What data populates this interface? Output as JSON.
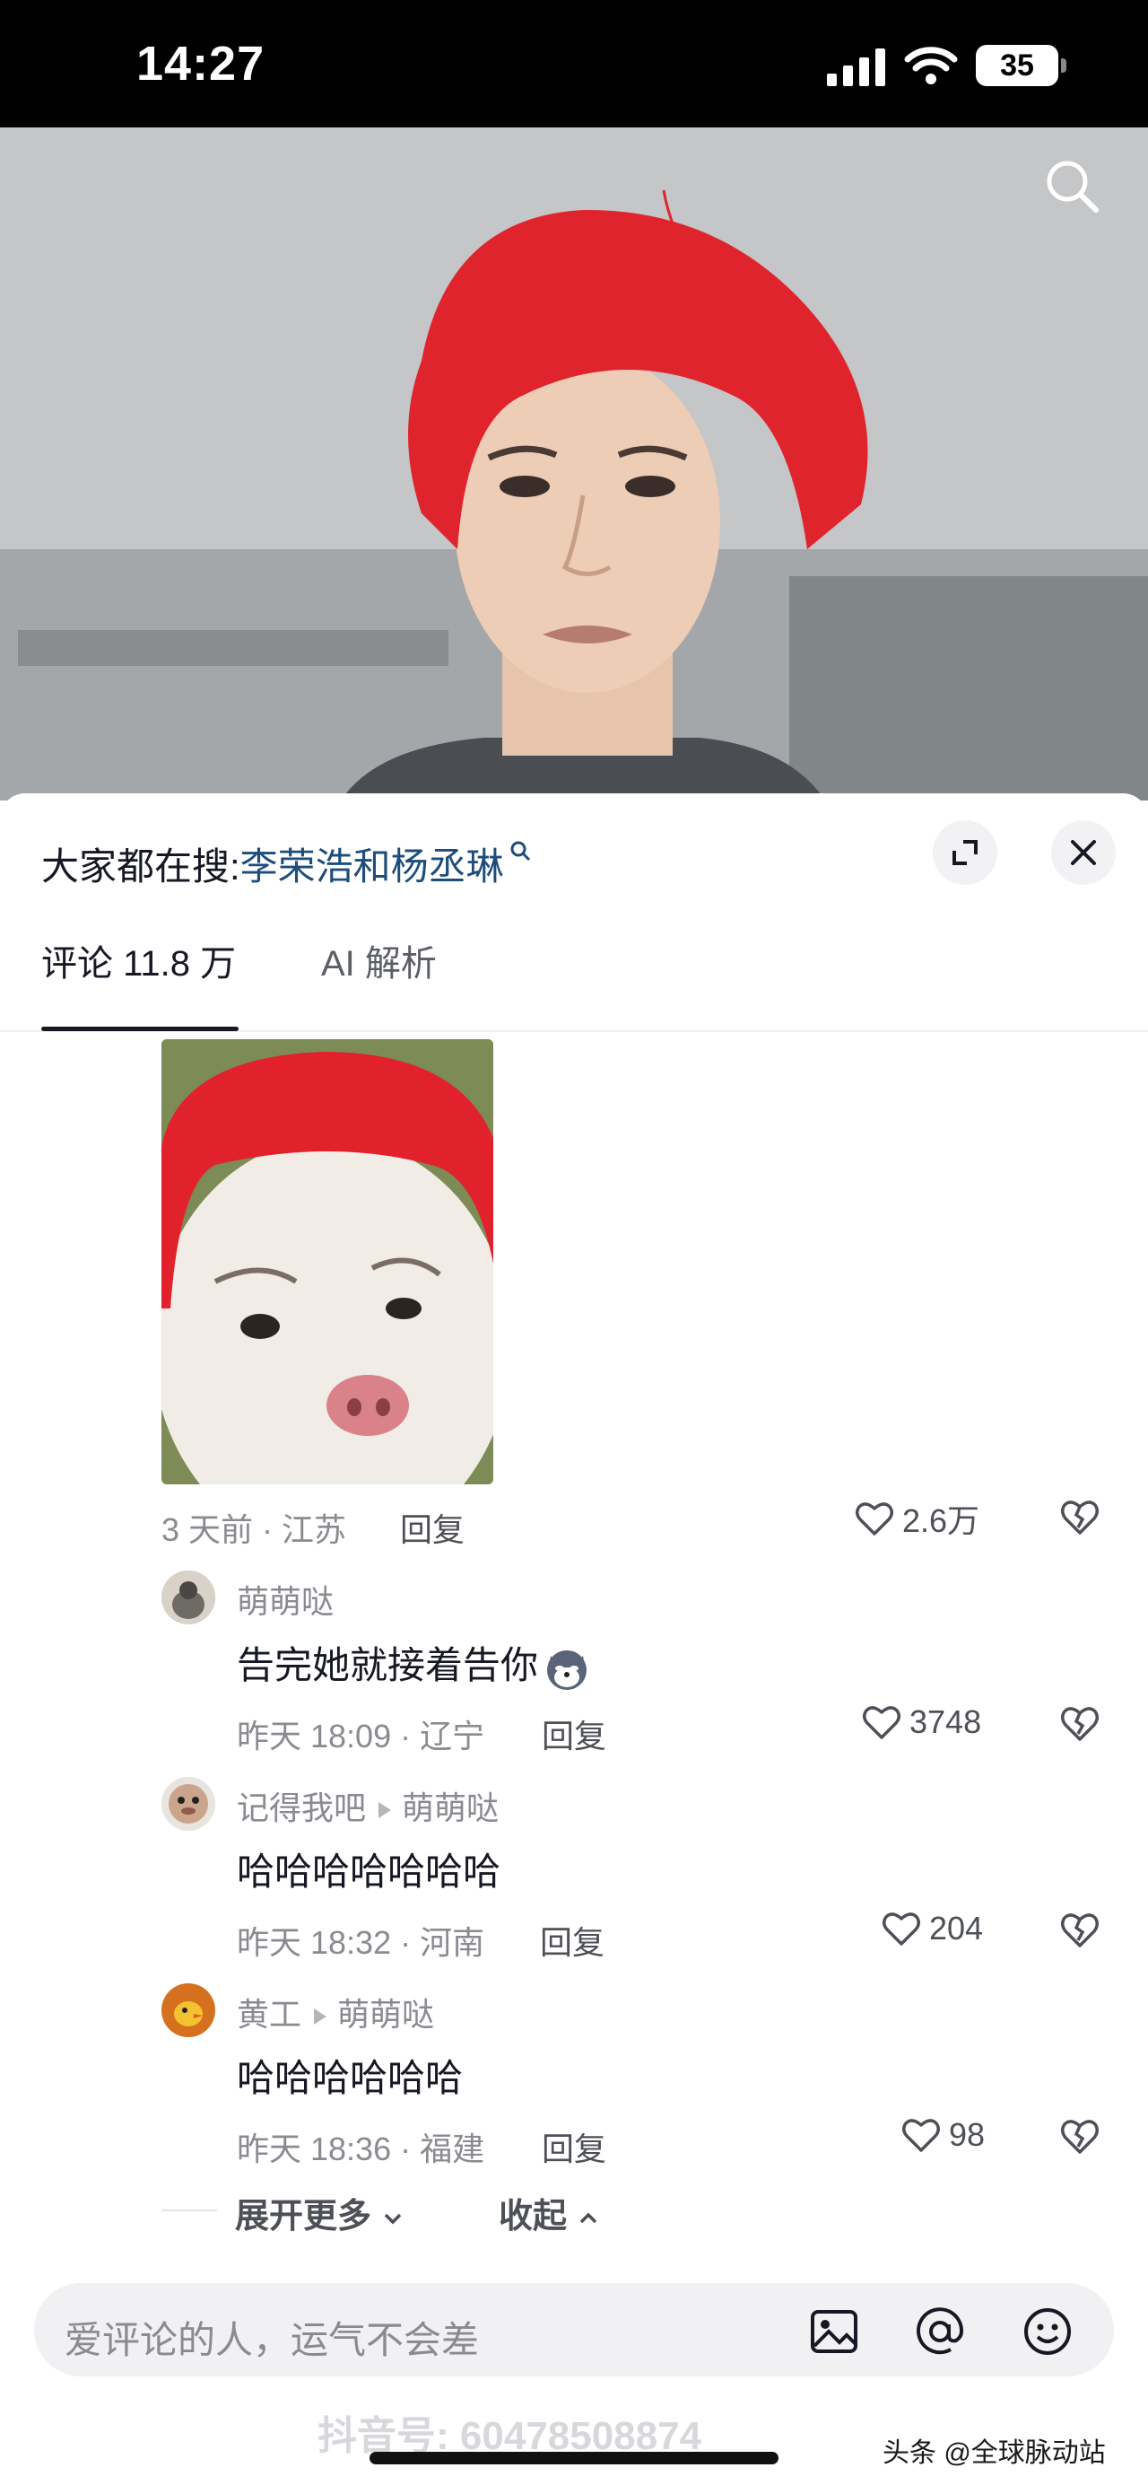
{
  "status_bar": {
    "time": "14:27",
    "battery": "35"
  },
  "search_hint": {
    "prefix": "大家都在搜:",
    "keyword": "李荣浩和杨丞琳"
  },
  "tabs": [
    {
      "label": "评论 11.8 万"
    },
    {
      "label": "AI 解析"
    }
  ],
  "main_comment": {
    "meta": "3 天前 · 江苏",
    "reply_label": "回复",
    "likes": "2.6万"
  },
  "replies": [
    {
      "user": "萌萌哒",
      "reply_to": "",
      "text": "告完她就接着告你",
      "meta": "昨天 18:09 · 辽宁",
      "reply_label": "回复",
      "likes": "3748"
    },
    {
      "user": "记得我吧",
      "reply_to": "萌萌哒",
      "text": "哈哈哈哈哈哈哈",
      "meta": "昨天 18:32 · 河南",
      "reply_label": "回复",
      "likes": "204"
    },
    {
      "user": "黄工",
      "reply_to": "萌萌哒",
      "text": "哈哈哈哈哈哈",
      "meta": "昨天 18:36 · 福建",
      "reply_label": "回复",
      "likes": "98"
    }
  ],
  "expand_more": "展开更多",
  "collapse": "收起",
  "input": {
    "placeholder": "爱评论的人，运气不会差"
  },
  "watermark": "抖音号: 60478508874",
  "source_credit": "头条 @全球脉动站",
  "colors": {
    "keyword": "#1d4d7c",
    "hair": "#e0242e"
  }
}
